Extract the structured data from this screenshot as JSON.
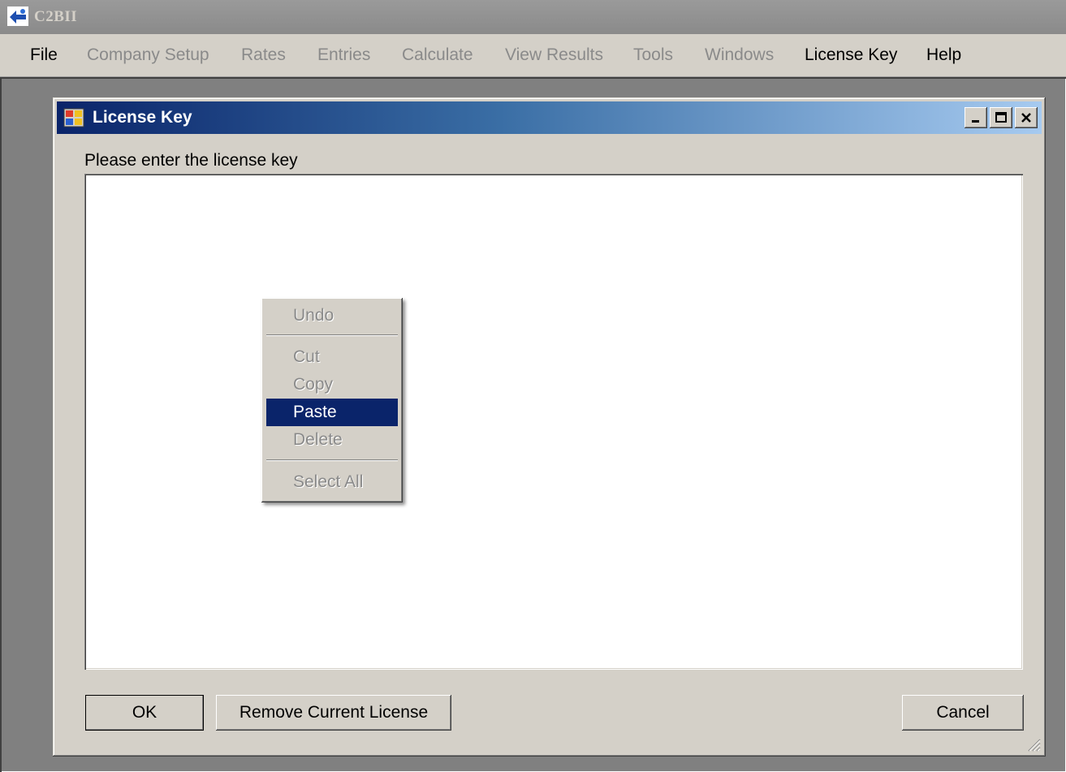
{
  "app": {
    "title": "C2BII"
  },
  "menubar": {
    "items": [
      {
        "label": "File",
        "enabled": true
      },
      {
        "label": "Company Setup",
        "enabled": false
      },
      {
        "label": "Rates",
        "enabled": false
      },
      {
        "label": "Entries",
        "enabled": false
      },
      {
        "label": "Calculate",
        "enabled": false
      },
      {
        "label": "View Results",
        "enabled": false
      },
      {
        "label": "Tools",
        "enabled": false
      },
      {
        "label": "Windows",
        "enabled": false
      },
      {
        "label": "License Key",
        "enabled": true
      },
      {
        "label": "Help",
        "enabled": true
      }
    ]
  },
  "dialog": {
    "title": "License Key",
    "prompt": "Please enter the license key",
    "license_value": "",
    "buttons": {
      "ok": "OK",
      "remove": "Remove Current License",
      "cancel": "Cancel"
    },
    "caption_icons": [
      "minimize-icon",
      "maximize-icon",
      "close-icon"
    ]
  },
  "context_menu": {
    "items": [
      {
        "label": "Undo",
        "enabled": false
      },
      {
        "label": "Cut",
        "enabled": false
      },
      {
        "label": "Copy",
        "enabled": false
      },
      {
        "label": "Paste",
        "enabled": true,
        "highlighted": true
      },
      {
        "label": "Delete",
        "enabled": false
      },
      {
        "label": "Select All",
        "enabled": false
      }
    ]
  },
  "colors": {
    "accent": "#0a246a",
    "face": "#d4d0c8",
    "workspace": "#808080"
  }
}
